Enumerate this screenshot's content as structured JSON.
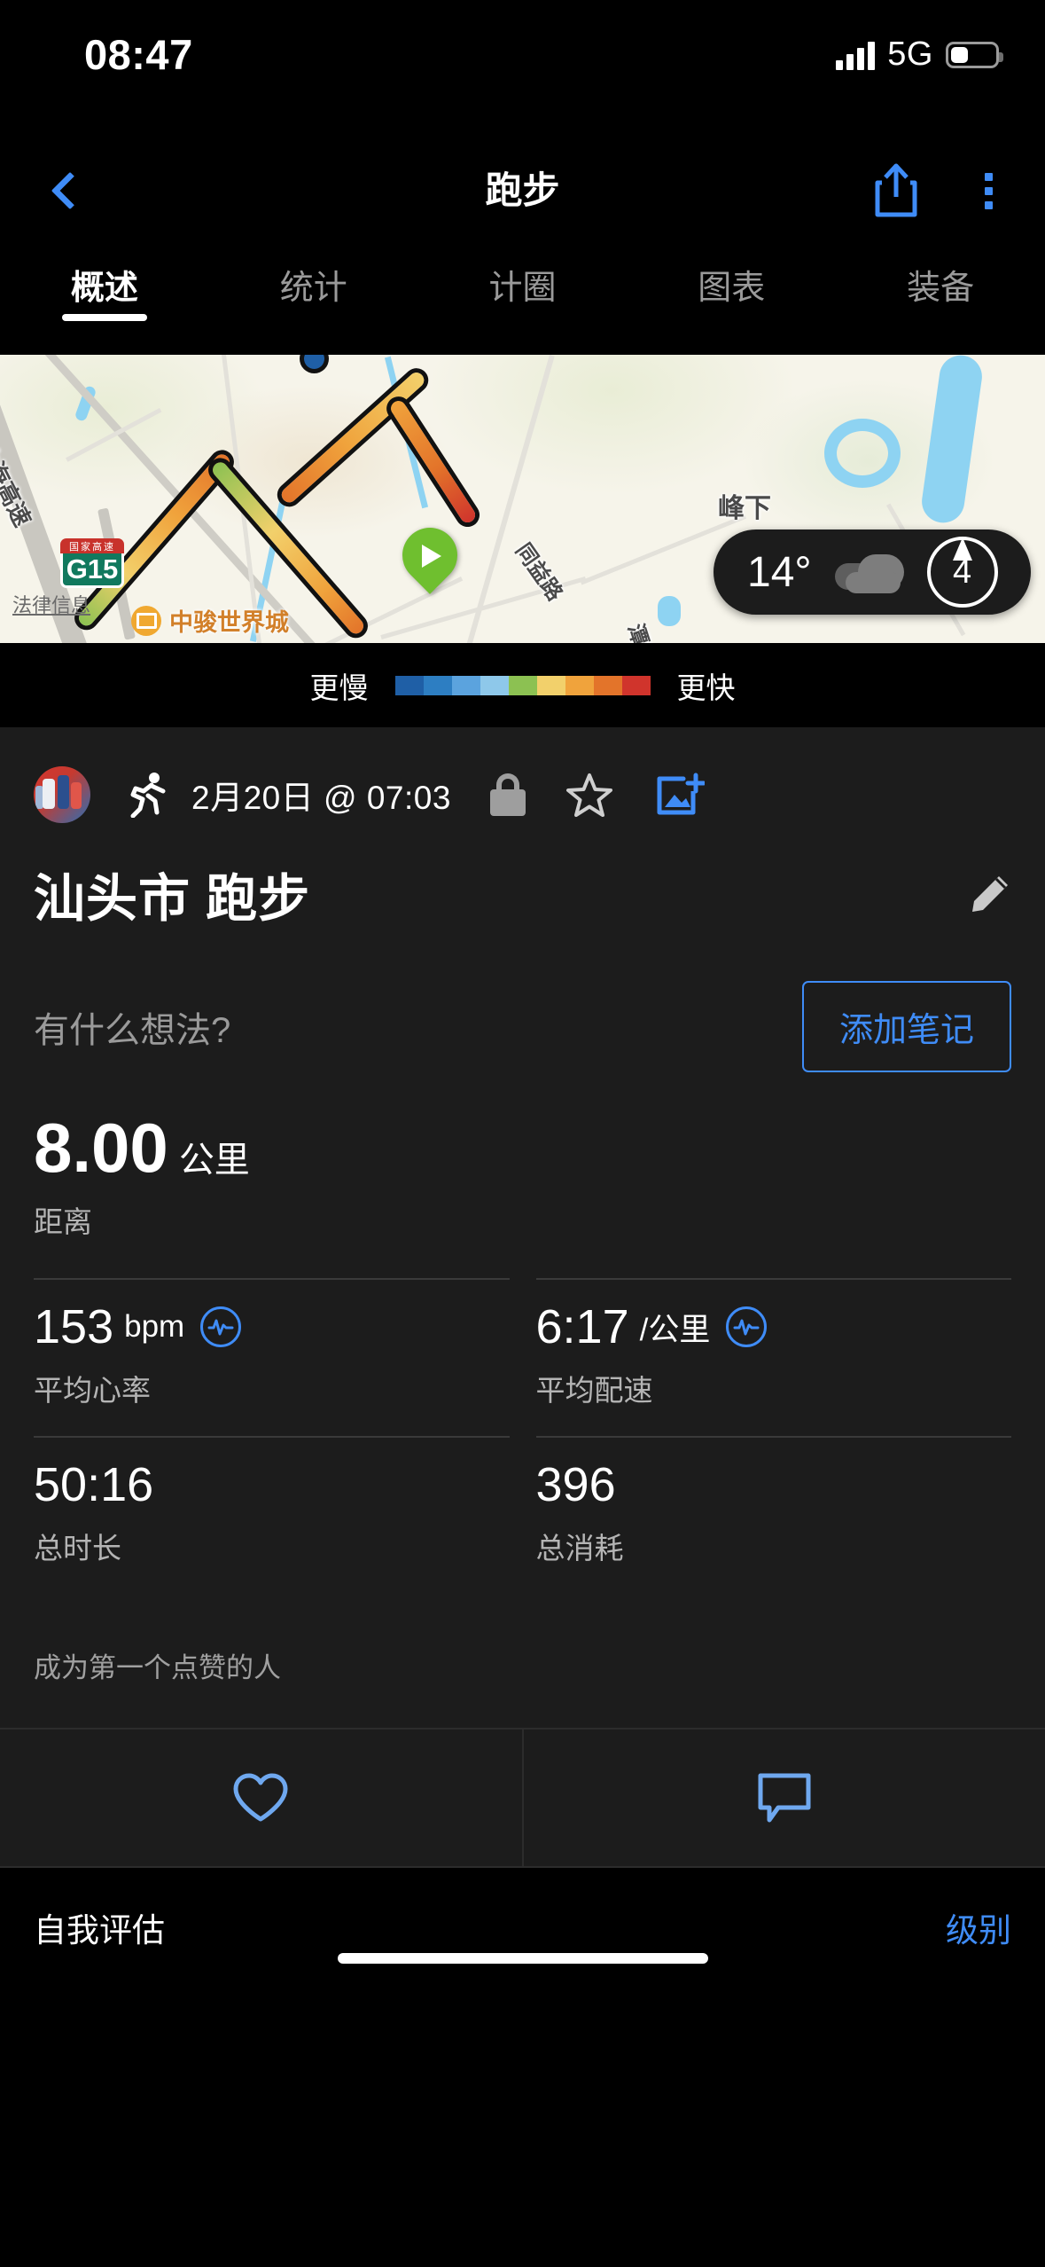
{
  "status_bar": {
    "time": "08:47",
    "network": "5G",
    "signal_icon": "signal-bars-icon",
    "battery_icon": "battery-icon"
  },
  "nav": {
    "back_icon": "chevron-left-icon",
    "title": "跑步",
    "share_icon": "share-icon",
    "more_icon": "kebab-menu-icon"
  },
  "tabs": [
    {
      "label": "概述",
      "active": true
    },
    {
      "label": "统计",
      "active": false
    },
    {
      "label": "计圈",
      "active": false
    },
    {
      "label": "图表",
      "active": false
    },
    {
      "label": "装备",
      "active": false
    }
  ],
  "map": {
    "labels": [
      "沈海高速",
      "峰下",
      "同益路",
      "潭路"
    ],
    "shield": {
      "top": "国家高速",
      "number": "G15"
    },
    "poi": "中骏世界城",
    "legal_link": "法律信息",
    "start_marker_icon": "start-play-pin-icon",
    "weather": {
      "temperature": "14°",
      "condition_icon": "cloudy-icon",
      "wind_icon": "wind-direction-icon",
      "wind_value": "4"
    }
  },
  "legend": {
    "slower": "更慢",
    "faster": "更快",
    "colors": [
      "#1f5fa6",
      "#2d7ec2",
      "#5ba3de",
      "#8ec8ea",
      "#8cc152",
      "#f2d06b",
      "#f0a33c",
      "#e3742a",
      "#d0342c"
    ]
  },
  "activity": {
    "avatar_icon": "avatar",
    "sport_icon": "running-icon",
    "datetime": "2月20日 @ 07:03",
    "privacy_icon": "lock-icon",
    "star_icon": "star-outline-icon",
    "add_photo_icon": "add-photo-icon",
    "title": "汕头市 跑步",
    "edit_icon": "pencil-icon"
  },
  "note": {
    "placeholder": "有什么想法?",
    "button_label": "添加笔记"
  },
  "stats": {
    "primary": {
      "value": "8.00",
      "unit": "公里",
      "label": "距离"
    },
    "cells": [
      {
        "value": "153",
        "unit": "bpm",
        "label": "平均心率",
        "badge_icon": "heart-rate-graph-icon"
      },
      {
        "value": "6:17",
        "unit": "/公里",
        "label": "平均配速",
        "badge_icon": "pace-graph-icon"
      },
      {
        "value": "50:16",
        "unit": "",
        "label": "总时长",
        "badge_icon": ""
      },
      {
        "value": "396",
        "unit": "",
        "label": "总消耗",
        "badge_icon": ""
      }
    ]
  },
  "social": {
    "kudos_text": "成为第一个点赞的人",
    "like_icon": "heart-outline-icon",
    "comment_icon": "comment-bubble-icon"
  },
  "footer": {
    "left_label": "自我评估",
    "right_label": "级别",
    "home_indicator": "home-indicator"
  },
  "theme": {
    "accent": "#3f8cf7",
    "bg": "#000000",
    "card_bg": "#1c1c1c",
    "muted": "#b4b4b4"
  }
}
